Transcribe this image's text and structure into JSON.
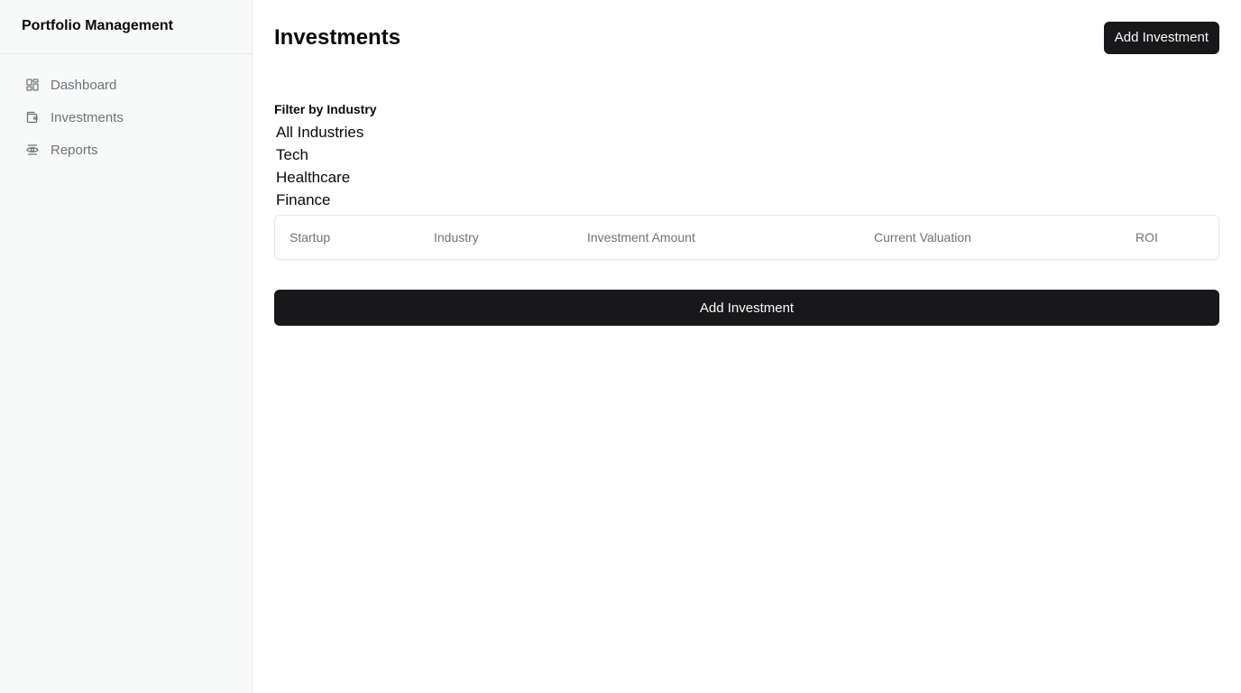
{
  "sidebar": {
    "brand": "Portfolio Management",
    "items": [
      {
        "label": "Dashboard",
        "icon": "dashboard-icon"
      },
      {
        "label": "Investments",
        "icon": "wallet-icon"
      },
      {
        "label": "Reports",
        "icon": "eye-icon"
      }
    ]
  },
  "header": {
    "title": "Investments",
    "add_button_label": "Add Investment"
  },
  "filter": {
    "label": "Filter by Industry",
    "options": [
      "All Industries",
      "Tech",
      "Healthcare",
      "Finance"
    ]
  },
  "table": {
    "columns": [
      "Startup",
      "Industry",
      "Investment Amount",
      "Current Valuation",
      "ROI"
    ],
    "rows": []
  },
  "footer": {
    "add_button_label": "Add Investment"
  },
  "colors": {
    "primary_button": "#18181b",
    "sidebar_bg": "#f8faf9",
    "muted_text": "#71717a",
    "border": "#e7e7ea"
  }
}
